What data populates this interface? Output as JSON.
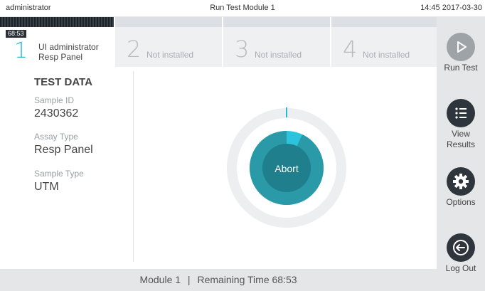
{
  "titlebar": {
    "user": "administrator",
    "title": "Run Test Module 1",
    "datetime": "14:45 2017-03-30"
  },
  "tabs": [
    {
      "number": "1",
      "timer": "68:53",
      "line1": "UI administrator",
      "line2": "Resp Panel",
      "active": true
    },
    {
      "number": "2",
      "label": "Not installed",
      "active": false
    },
    {
      "number": "3",
      "label": "Not installed",
      "active": false
    },
    {
      "number": "4",
      "label": "Not installed",
      "active": false
    }
  ],
  "test_data": {
    "heading": "TEST DATA",
    "fields": [
      {
        "label": "Sample ID",
        "value": "2430362"
      },
      {
        "label": "Assay Type",
        "value": "Resp Panel"
      },
      {
        "label": "Sample Type",
        "value": "UTM"
      }
    ]
  },
  "progress": {
    "abort_label": "Abort",
    "fraction_complete": 0.07,
    "colors": {
      "ring": "#eceeef",
      "outer": "#2cc4dc",
      "inner": "#1f7f8c",
      "inner_light": "#2a99a8",
      "tick": "#2bb7d3"
    }
  },
  "sidebar": {
    "run_test": {
      "label": "Run Test",
      "icon": "play-icon"
    },
    "view_results": {
      "line1": "View",
      "line2": "Results",
      "icon": "list-icon"
    },
    "options": {
      "label": "Options",
      "icon": "gear-icon"
    },
    "log_out": {
      "label": "Log Out",
      "icon": "logout-icon"
    }
  },
  "status_bar": {
    "module": "Module 1",
    "separator": "|",
    "remaining_label": "Remaining Time",
    "remaining_time": "68:53"
  }
}
